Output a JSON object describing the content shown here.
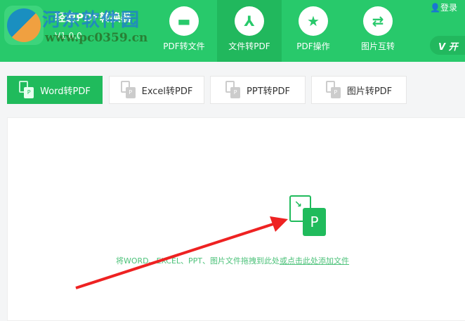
{
  "app": {
    "name": "轻速PDF转换器",
    "version": "V1.0.0",
    "watermark_title": "河东软件园",
    "watermark_url": "www.pc0359.cn"
  },
  "nav": [
    {
      "label": "PDF转文件",
      "icon": "folder-icon"
    },
    {
      "label": "文件转PDF",
      "icon": "pdf-icon",
      "active": true
    },
    {
      "label": "PDF操作",
      "icon": "star-icon"
    },
    {
      "label": "图片互转",
      "icon": "swap-icon"
    }
  ],
  "header": {
    "login": "登录",
    "vip": "开"
  },
  "tabs": [
    {
      "label": "Word转PDF",
      "active": true
    },
    {
      "label": "Excel转PDF"
    },
    {
      "label": "PPT转PDF"
    },
    {
      "label": "图片转PDF"
    }
  ],
  "drop": {
    "icon_letter": "P",
    "hint": "将WORD、EXCEL、PPT、图片文件拖拽到此处",
    "link": "或点击此处添加文件"
  },
  "colors": {
    "brand": "#28c96b",
    "active": "#21b85d",
    "annotation": "#ee2222"
  }
}
